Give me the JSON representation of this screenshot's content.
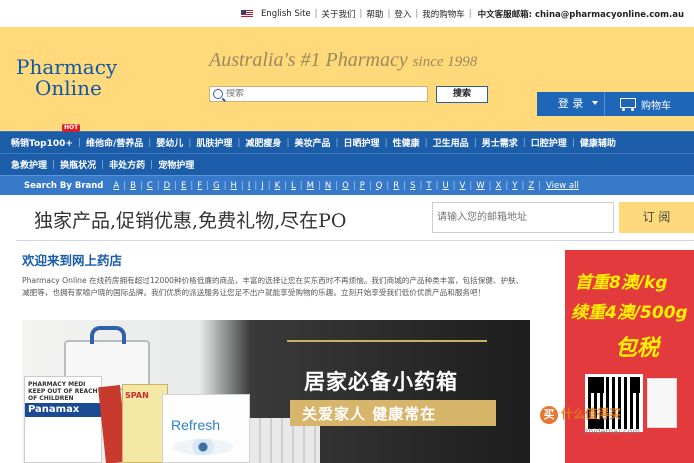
{
  "topbar": {
    "english": "English Site",
    "about": "关于我们",
    "help": "帮助",
    "login": "登入",
    "mycart": "我的购物车",
    "contact": "中文客服邮箱: china@pharmacyonline.com.au"
  },
  "header": {
    "logo_line1": "Pharmacy",
    "logo_line2": "Online",
    "tagline": "Australia's #1 Pharmacy",
    "since": "since 1998",
    "search_placeholder": "搜索",
    "search_button": "搜索",
    "login_label": "登 录",
    "cart_label": "购物车"
  },
  "nav": {
    "row1": [
      "畅销Top100+",
      "维他命/营养品",
      "婴幼儿",
      "肌肤护理",
      "减肥瘦身",
      "美妆产品",
      "日晒护理",
      "性健康",
      "卫生用品",
      "男士需求",
      "口腔护理",
      "健康辅助"
    ],
    "row2": [
      "急救护理",
      "换瓶状况",
      "非处方药",
      "宠物护理"
    ],
    "hot": "HOT"
  },
  "brandbar": {
    "label": "Search By Brand",
    "letters": [
      "A",
      "B",
      "C",
      "D",
      "E",
      "F",
      "G",
      "H",
      "I",
      "J",
      "K",
      "L",
      "M",
      "N",
      "O",
      "P",
      "Q",
      "R",
      "S",
      "T",
      "U",
      "V",
      "W",
      "X",
      "Y",
      "Z"
    ],
    "view_all": "View all"
  },
  "promo": {
    "text": "独家产品,促销优惠,免费礼物,尽在PO",
    "email_placeholder": "请输入您的邮箱地址",
    "subscribe": "订 阅"
  },
  "main": {
    "welcome": "欢迎来到网上药店",
    "description": "Pharmacy Online 在线药房拥有超过12000种价格低廉的商品，丰富的选择让您在买东西时不再烦恼。我们商城的产品种类丰富，包括保健、护肤、减肥等，也拥有家喻户晓的国际品牌。我们优质的派送服务让您足不出户就能享受购物的乐趣。立刻开始享受我们低价优质产品和服务吧！"
  },
  "banner": {
    "box1_text": "PHARMACY MEDI KEEP OUT OF REACH OF CHILDREN",
    "box1_brand": "Panamax",
    "box2_brand": "SPAN",
    "box3_brand": "Refresh",
    "headline": "居家必备小药箱",
    "subline": "关爱家人 健康常在"
  },
  "ad": {
    "line1": "首重8澳/kg",
    "line2": "续重4澳/500g",
    "line3": "包税"
  },
  "watermark": {
    "icon": "买",
    "text": "什么值得买",
    "url": "zhidemai.com"
  }
}
